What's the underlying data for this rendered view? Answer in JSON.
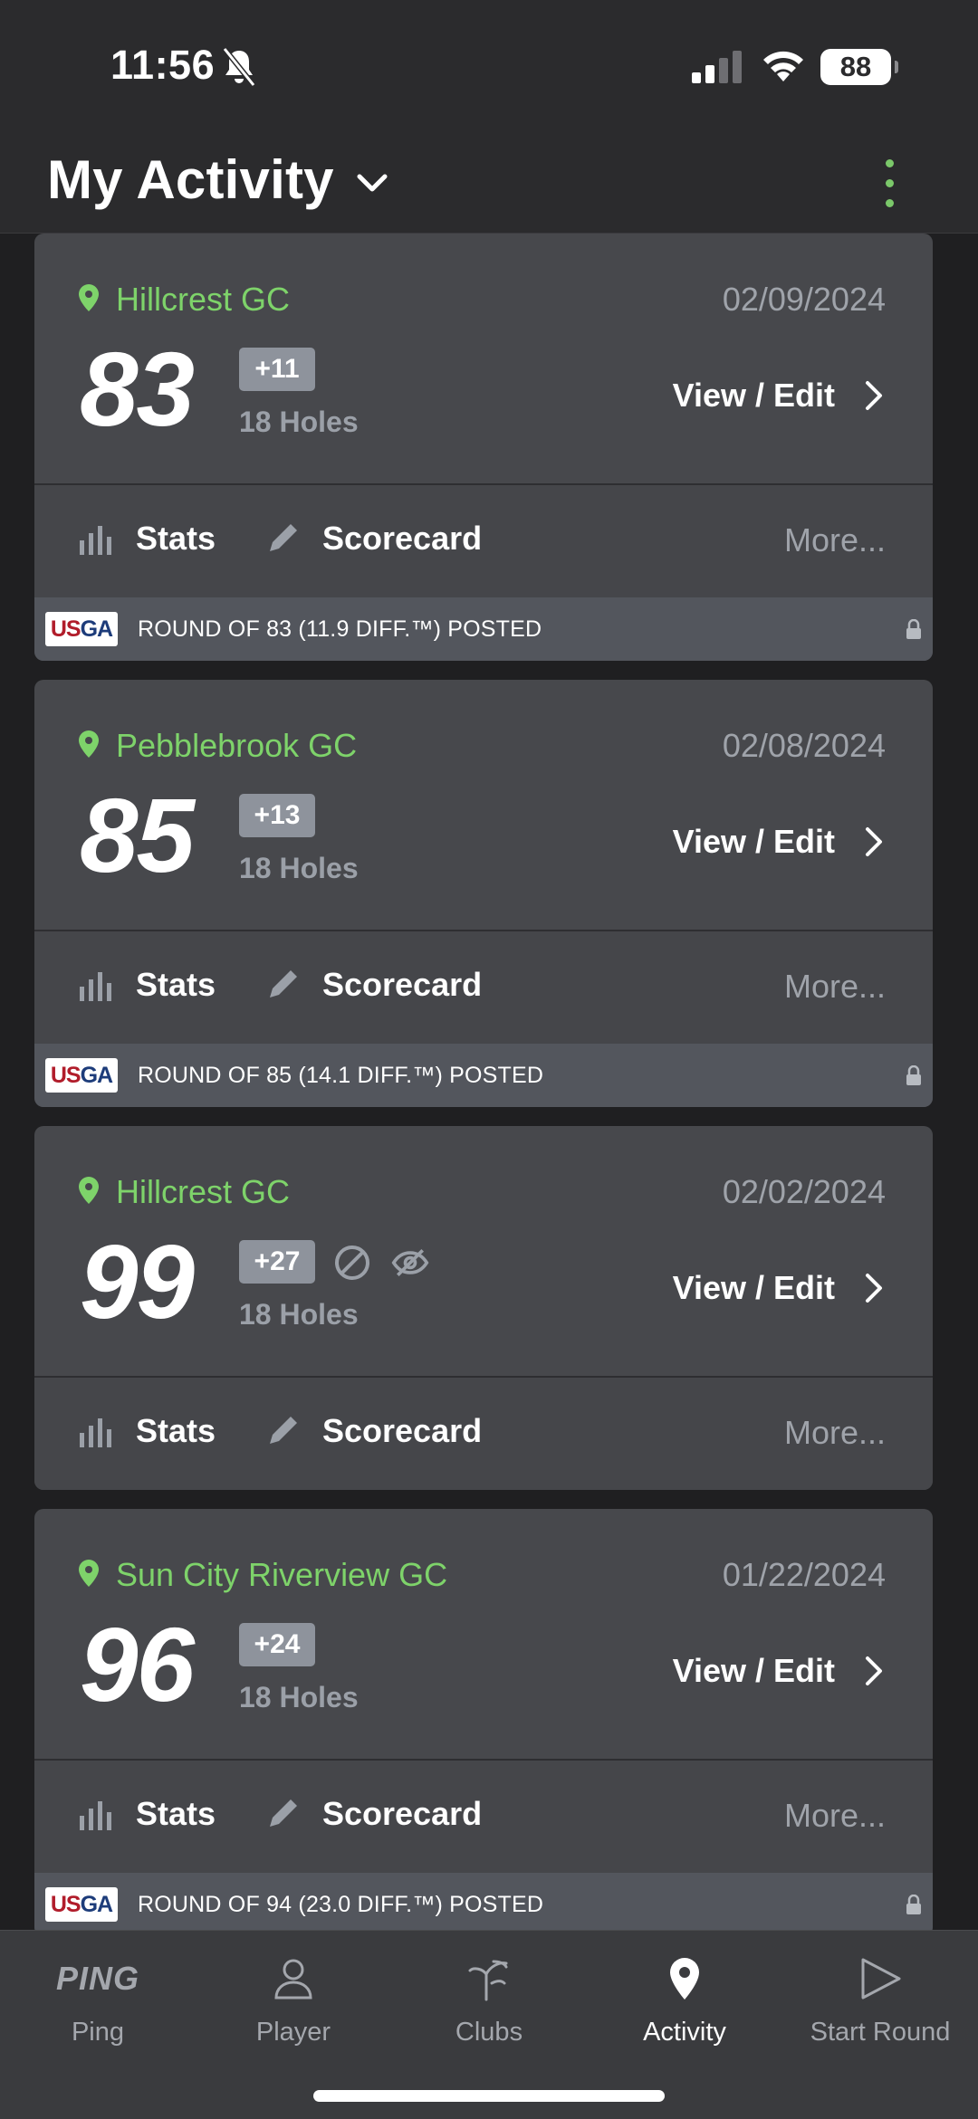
{
  "status_bar": {
    "time": "11:56",
    "battery": "88"
  },
  "header": {
    "title": "My Activity"
  },
  "rounds": [
    {
      "course": "Hillcrest GC",
      "date": "02/09/2024",
      "score": "83",
      "over_par": "+11",
      "holes": "18 Holes",
      "view_edit": "View / Edit",
      "stats": "Stats",
      "scorecard": "Scorecard",
      "more": "More...",
      "usga_text": "ROUND OF 83 (11.9  DIFF.™) POSTED"
    },
    {
      "course": "Pebblebrook GC",
      "date": "02/08/2024",
      "score": "85",
      "over_par": "+13",
      "holes": "18 Holes",
      "view_edit": "View / Edit",
      "stats": "Stats",
      "scorecard": "Scorecard",
      "more": "More...",
      "usga_text": "ROUND OF 85 (14.1  DIFF.™) POSTED"
    },
    {
      "course": "Hillcrest GC",
      "date": "02/02/2024",
      "score": "99",
      "over_par": "+27",
      "holes": "18 Holes",
      "view_edit": "View / Edit",
      "stats": "Stats",
      "scorecard": "Scorecard",
      "more": "More..."
    },
    {
      "course": "Sun City Riverview GC",
      "date": "01/22/2024",
      "score": "96",
      "over_par": "+24",
      "holes": "18 Holes",
      "view_edit": "View / Edit",
      "stats": "Stats",
      "scorecard": "Scorecard",
      "more": "More...",
      "usga_text": "ROUND OF 94 (23.0  DIFF.™) POSTED"
    }
  ],
  "usga_logo": {
    "us": "US",
    "ga": "GA"
  },
  "nav": [
    {
      "label": "Ping",
      "logo": "PING",
      "icon": "ping-logo"
    },
    {
      "label": "Player",
      "icon": "person-icon"
    },
    {
      "label": "Clubs",
      "icon": "clubs-icon"
    },
    {
      "label": "Activity",
      "icon": "map-pin-icon",
      "active": true
    },
    {
      "label": "Start Round",
      "icon": "play-icon"
    }
  ],
  "colors": {
    "accent_green": "#7ed36a",
    "card_bg": "#47484c",
    "usga_bar": "#53565d"
  }
}
